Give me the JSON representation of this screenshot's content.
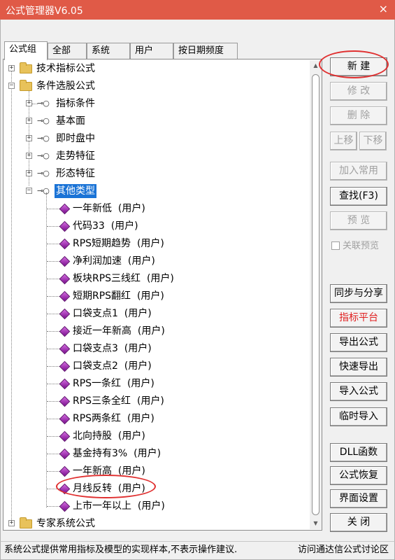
{
  "window": {
    "title": "公式管理器V6.05",
    "close_icon": "×"
  },
  "tabs": [
    {
      "label": "公式组",
      "active": true
    },
    {
      "label": "全部"
    },
    {
      "label": "系统"
    },
    {
      "label": "用户"
    },
    {
      "label": "按日期频度"
    }
  ],
  "tree": {
    "groups": [
      {
        "label": "技术指标公式",
        "expander": "+"
      },
      {
        "label": "条件选股公式",
        "expander": "−"
      },
      {
        "label": "专家系统公式",
        "expander": "+"
      }
    ],
    "subgroups": [
      {
        "label": "指标条件",
        "expander": "+"
      },
      {
        "label": "基本面",
        "expander": "+"
      },
      {
        "label": "即时盘中",
        "expander": "+"
      },
      {
        "label": "走势特征",
        "expander": "+"
      },
      {
        "label": "形态特征",
        "expander": "+"
      },
      {
        "label": "其他类型",
        "expander": "−",
        "selected": true
      }
    ],
    "items": [
      "一年新低  (用户)",
      "代码33  (用户)",
      "RPS短期趋势  (用户)",
      "净利润加速  (用户)",
      "板块RPS三线红  (用户)",
      "短期RPS翻红  (用户)",
      "口袋支点1  (用户)",
      "接近一年新高  (用户)",
      "口袋支点3  (用户)",
      "口袋支点2  (用户)",
      "RPS一条红  (用户)",
      "RPS三条全红  (用户)",
      "RPS两条红  (用户)",
      "北向持股  (用户)",
      "基金持有3%  (用户)",
      "一年新高  (用户)",
      "月线反转  (用户)",
      "上市一年以上  (用户)"
    ]
  },
  "buttons": {
    "new": "新 建",
    "modify": "修 改",
    "delete": "删 除",
    "move_up": "上移",
    "move_down": "下移",
    "add_common": "加入常用",
    "find": "查找(F3)",
    "preview": "预 览",
    "linked_preview": "关联预览",
    "sync_share": "同步与分享",
    "indicator_platform": "指标平台",
    "export": "导出公式",
    "quick_export": "快速导出",
    "import": "导入公式",
    "temp_import": "临时导入",
    "dll": "DLL函数",
    "restore": "公式恢复",
    "ui_settings": "界面设置",
    "close": "关 闭"
  },
  "status": {
    "left": "系统公式提供常用指标及模型的实现样本,不表示操作建议.",
    "right": "访问通达信公式讨论区"
  },
  "colors": {
    "titlebar": "#e05a47",
    "selection": "#1a73d6",
    "annotation": "#e03030",
    "red_button_text": "#e02020"
  }
}
